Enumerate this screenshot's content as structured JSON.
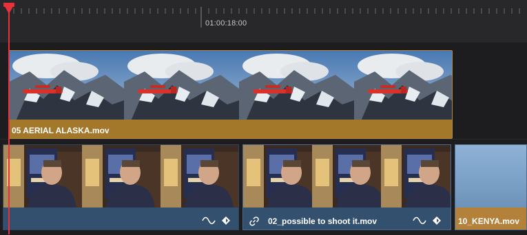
{
  "ruler": {
    "timecode": "01:00:18:00"
  },
  "tracks": {
    "v2": {
      "clip_name": "05 AERIAL  ALASKA.mov"
    },
    "v1": {
      "clips": [
        {
          "name": ""
        },
        {
          "name": "02_possible to shoot it.mov"
        },
        {
          "name": "10_KENYA.mov"
        }
      ]
    }
  },
  "colors": {
    "playhead": "#e8313b",
    "aerial_clip": "#a3782a",
    "video_clip": "#33506f",
    "kenya_bar": "#b3813a"
  },
  "icons": [
    "link-icon",
    "audio-waveform-icon",
    "keyframe-icon"
  ]
}
